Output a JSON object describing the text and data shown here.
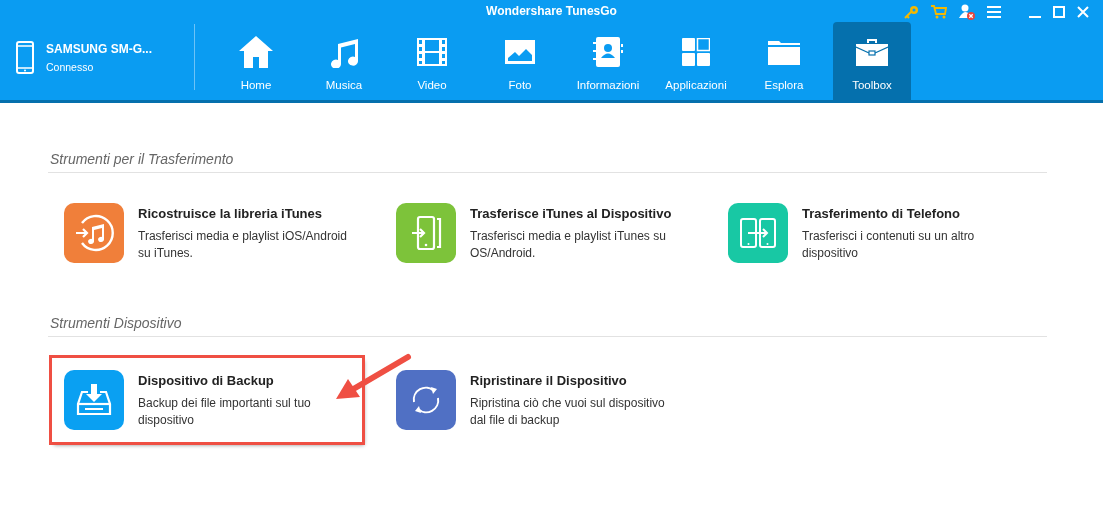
{
  "window": {
    "title": "Wondershare TunesGo"
  },
  "device": {
    "name": "SAMSUNG SM-G...",
    "status": "Connesso"
  },
  "nav": [
    {
      "label": "Home",
      "kind": "home",
      "selected": false
    },
    {
      "label": "Musica",
      "kind": "music",
      "selected": false
    },
    {
      "label": "Video",
      "kind": "film",
      "selected": false
    },
    {
      "label": "Foto",
      "kind": "photo",
      "selected": false
    },
    {
      "label": "Informazioni",
      "kind": "contacts",
      "selected": false
    },
    {
      "label": "Applicazioni",
      "kind": "apps",
      "selected": false
    },
    {
      "label": "Esplora",
      "kind": "folder",
      "selected": false
    },
    {
      "label": "Toolbox",
      "kind": "briefcase",
      "selected": true
    }
  ],
  "sections": [
    {
      "title": "Strumenti per il Trasferimento",
      "tools": [
        {
          "title": "Ricostruisce la libreria iTunes",
          "description": "Trasferisci media e playlist iOS/Android su iTunes.",
          "kind": "rebuild",
          "color": "#f07f3a",
          "highlighted": false
        },
        {
          "title": "Trasferisce iTunes al Dispositivo",
          "description": "Trasferisci media e playlist iTunes su OS/Android.",
          "kind": "to-device",
          "color": "#7dc33a",
          "highlighted": false
        },
        {
          "title": "Trasferimento di Telefono",
          "description": "Trasferisci i contenuti su un altro dispositivo",
          "kind": "phone-transfer",
          "color": "#18c8a4",
          "highlighted": false
        }
      ]
    },
    {
      "title": "Strumenti Dispositivo",
      "tools": [
        {
          "title": "Dispositivo di Backup",
          "description": "Backup dei file importanti sul tuo dispositivo",
          "kind": "backup",
          "color": "#0aa0f2",
          "highlighted": true
        },
        {
          "title": "Ripristinare il Dispositivo",
          "description": "Ripristina ciò che vuoi sul dispositivo dal file di backup",
          "kind": "restore",
          "color": "#5070c4",
          "highlighted": false
        }
      ]
    }
  ]
}
